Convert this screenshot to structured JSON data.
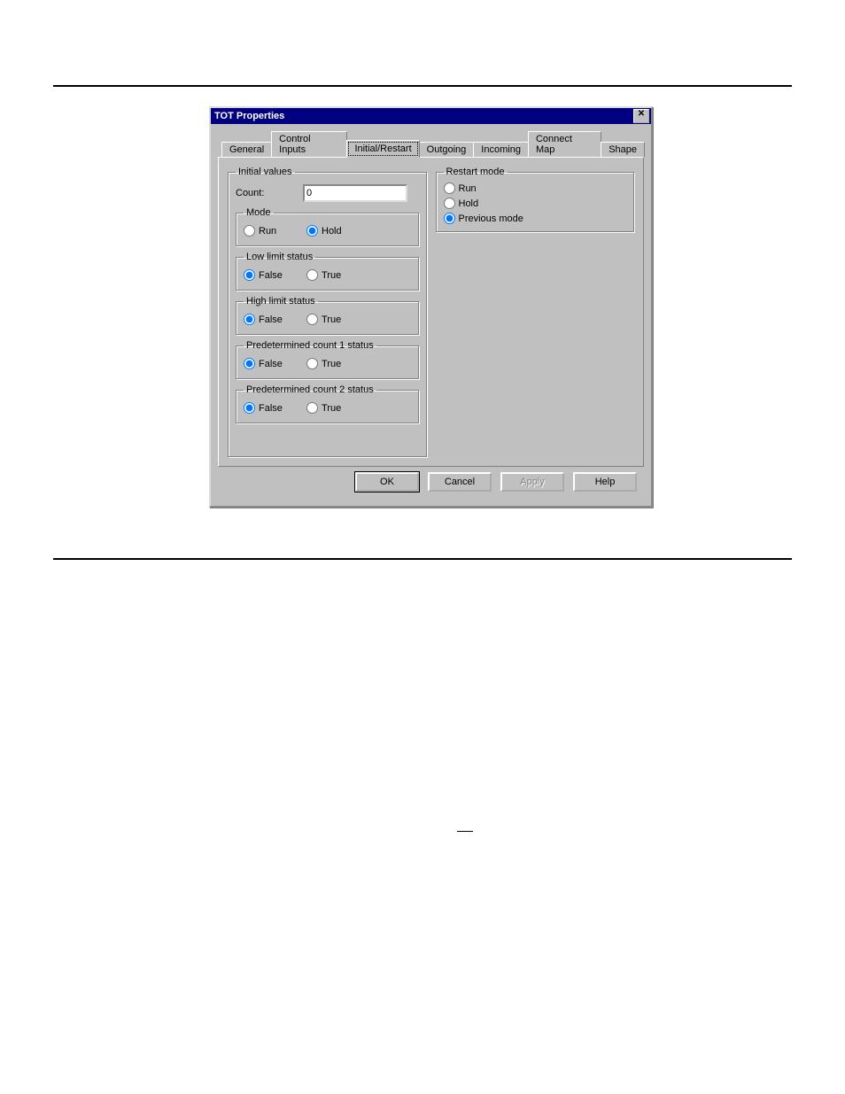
{
  "dialog": {
    "title": "TOT Properties",
    "tabs": {
      "general": "General",
      "control_inputs": "Control Inputs",
      "initial_restart": "Initial/Restart",
      "outgoing": "Outgoing",
      "incoming": "Incoming",
      "connect_map": "Connect Map",
      "shape": "Shape"
    },
    "active_tab": "initial_restart",
    "initial_values": {
      "legend": "Initial values",
      "count_label": "Count:",
      "count_value": "0",
      "mode": {
        "legend": "Mode",
        "run": "Run",
        "hold": "Hold",
        "selected": "hold"
      },
      "low_limit": {
        "legend": "Low limit status",
        "false": "False",
        "true": "True",
        "selected": "false"
      },
      "high_limit": {
        "legend": "High limit status",
        "false": "False",
        "true": "True",
        "selected": "false"
      },
      "pc1": {
        "legend": "Predetermined count 1 status",
        "false": "False",
        "true": "True",
        "selected": "false"
      },
      "pc2": {
        "legend": "Predetermined count 2 status",
        "false": "False",
        "true": "True",
        "selected": "false"
      }
    },
    "restart_mode": {
      "legend": "Restart mode",
      "run": "Run",
      "hold": "Hold",
      "previous": "Previous mode",
      "selected": "previous"
    },
    "buttons": {
      "ok": "OK",
      "cancel": "Cancel",
      "apply": "Apply",
      "help": "Help"
    }
  }
}
